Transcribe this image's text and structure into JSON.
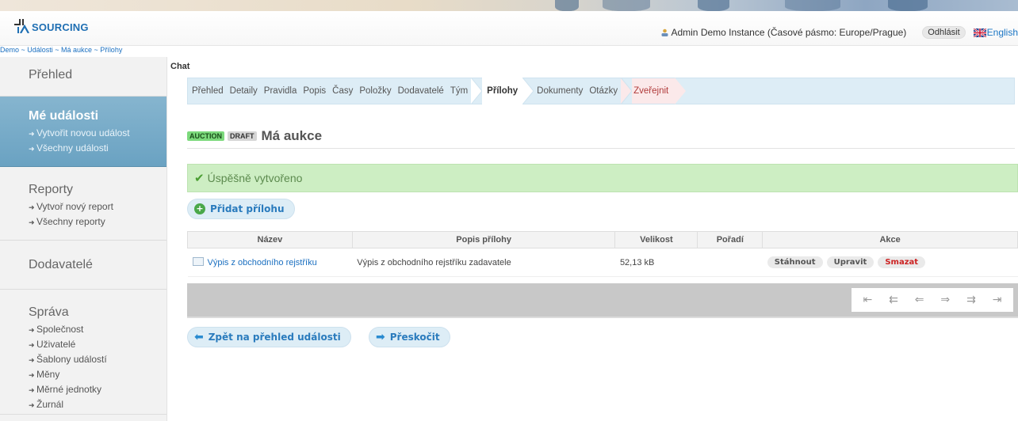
{
  "header": {
    "logo_text": "SOURCING",
    "user_text": "Admin Demo Instance (Časové pásmo: Europe/Prague)",
    "logout_label": "Odhlásit",
    "language_label": "English"
  },
  "breadcrumb": "Demo ~ Události ~ Má aukce ~ Přílohy",
  "sidebar": {
    "overview": "Přehled",
    "my_events": {
      "title": "Mé události",
      "items": [
        "Vytvořit novou událost",
        "Všechny události"
      ]
    },
    "reports": {
      "title": "Reporty",
      "items": [
        "Vytvoř nový report",
        "Všechny reporty"
      ]
    },
    "suppliers": "Dodavatelé",
    "admin": {
      "title": "Správa",
      "items": [
        "Společnost",
        "Uživatelé",
        "Šablony událostí",
        "Měny",
        "Měrné jednotky",
        "Žurnál"
      ]
    }
  },
  "main": {
    "chat_label": "Chat",
    "steps": [
      "Přehled",
      "Detaily",
      "Pravidla",
      "Popis",
      "Časy",
      "Položky",
      "Dodavatelé",
      "Tým",
      "Přílohy",
      "Dokumenty",
      "Otázky",
      "Zveřejnit"
    ],
    "badge_auction": "AUCTION",
    "badge_draft": "DRAFT",
    "page_title": "Má aukce",
    "success_message": "Úspěšně vytvořeno",
    "add_attachment_label": "Přidat přílohu",
    "table": {
      "headers": [
        "Název",
        "Popis přílohy",
        "Velikost",
        "Pořadí",
        "Akce"
      ],
      "rows": [
        {
          "name": "Výpis z obchodního rejstříku",
          "description": "Výpis z obchodního rejstříku zadavatele",
          "size": "52,13 kB",
          "order": "",
          "actions": [
            "Stáhnout",
            "Upravit",
            "Smazat"
          ]
        }
      ]
    },
    "back_label": "Zpět na přehled události",
    "skip_label": "Přeskočit"
  },
  "colors": {
    "accent": "#2a7bbd",
    "active_sidebar": "#6aa2c2",
    "success_bg": "#cdeec3",
    "delete": "#cc2222"
  }
}
